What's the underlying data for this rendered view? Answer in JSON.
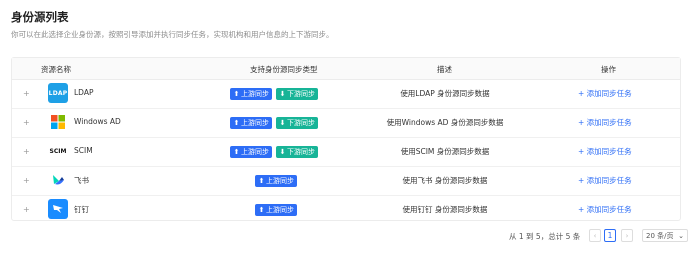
{
  "page": {
    "title": "身份源列表",
    "description": "你可以在此选择企业身份源，按照引导添加并执行同步任务，实现机构和用户信息的上下游同步。"
  },
  "table": {
    "headers": {
      "name": "资源名称",
      "type": "支持身份源同步类型",
      "desc": "描述",
      "action": "操作"
    },
    "rows": [
      {
        "expand": "+",
        "logo_text": "LDAP",
        "logo_icon": "ldap-logo",
        "name": "LDAP",
        "badges": [
          {
            "label": "上游同步",
            "kind": "up"
          },
          {
            "label": "下游同步",
            "kind": "down"
          }
        ],
        "desc": "使用LDAP 身份源同步数据",
        "action": "+ 添加同步任务"
      },
      {
        "expand": "+",
        "logo_icon": "windows-logo",
        "name": "Windows AD",
        "badges": [
          {
            "label": "上游同步",
            "kind": "up"
          },
          {
            "label": "下游同步",
            "kind": "down"
          }
        ],
        "desc": "使用Windows AD 身份源同步数据",
        "action": "+ 添加同步任务"
      },
      {
        "expand": "+",
        "logo_text": "SCIM",
        "logo_icon": "scim-logo",
        "name": "SCIM",
        "badges": [
          {
            "label": "上游同步",
            "kind": "up"
          },
          {
            "label": "下游同步",
            "kind": "down"
          }
        ],
        "desc": "使用SCIM 身份源同步数据",
        "action": "+ 添加同步任务"
      },
      {
        "expand": "+",
        "logo_icon": "feishu-logo",
        "name": "飞书",
        "badges": [
          {
            "label": "上游同步",
            "kind": "up"
          }
        ],
        "desc": "使用飞书 身份源同步数据",
        "action": "+ 添加同步任务"
      },
      {
        "expand": "+",
        "logo_icon": "dingtalk-logo",
        "name": "钉钉",
        "badges": [
          {
            "label": "上游同步",
            "kind": "up"
          }
        ],
        "desc": "使用钉钉 身份源同步数据",
        "action": "+ 添加同步任务"
      }
    ]
  },
  "pagination": {
    "total_text": "从 1 到 5，总计 5 条",
    "prev": "‹",
    "current_page": "1",
    "next": "›",
    "page_size": "20 条/页",
    "page_size_arrow": "⌄"
  },
  "colors": {
    "accent": "#2d6df6",
    "up_badge": "#2d6df6",
    "down_badge": "#17b497",
    "ldap": "#1ea0e6"
  }
}
